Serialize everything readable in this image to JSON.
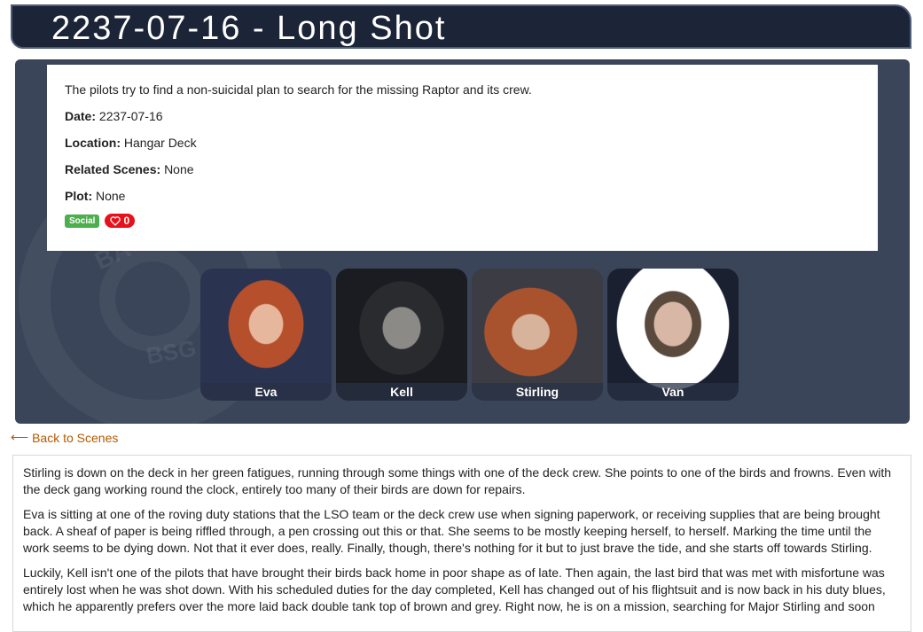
{
  "title": "2237-07-16 - Long Shot",
  "summary": "The pilots try to find a non-suicidal plan to search for the missing Raptor and its crew.",
  "fields": {
    "date_label": "Date:",
    "date_value": "2237-07-16",
    "location_label": "Location:",
    "location_value": "Hangar Deck",
    "related_label": "Related Scenes:",
    "related_value": "None",
    "plot_label": "Plot:",
    "plot_value": "None"
  },
  "tags": {
    "social": "Social",
    "likes": "0"
  },
  "emblem": {
    "text1": "BA",
    "text2": "BSG"
  },
  "participants": [
    {
      "name": "Eva"
    },
    {
      "name": "Kell"
    },
    {
      "name": "Stirling"
    },
    {
      "name": "Van"
    }
  ],
  "back_link": "Back to Scenes",
  "log": [
    "Stirling is down on the deck in her green fatigues, running through some things with one of the deck crew. She points to one of the birds and frowns. Even with the deck gang working round the clock, entirely too many of their birds are down for repairs.",
    "Eva is sitting at one of the roving duty stations that the LSO team or the deck crew use when signing paperwork, or receiving supplies that are being brought back. A sheaf of paper is being riffled through, a pen crossing out this or that. She seems to be mostly keeping herself, to herself. Marking the time until the work seems to be dying down. Not that it ever does, really. Finally, though, there's nothing for it but to just brave the tide, and she starts off towards Stirling.",
    "Luckily, Kell isn't one of the pilots that have brought their birds back home in poor shape as of late. Then again, the last bird that was met with misfortune was entirely lost when he was shot down. With his scheduled duties for the day completed, Kell has changed out of his flightsuit and is now back in his duty blues, which he apparently prefers over the more laid back double tank top of brown and grey. Right now, he is on a mission, searching for Major Stirling and soon"
  ],
  "colors": {
    "title_bg": "#1c2538",
    "panel_bg": "#3a4559",
    "social_tag": "#4cae4c",
    "like_badge": "#e8101a",
    "link": "#b35900"
  }
}
